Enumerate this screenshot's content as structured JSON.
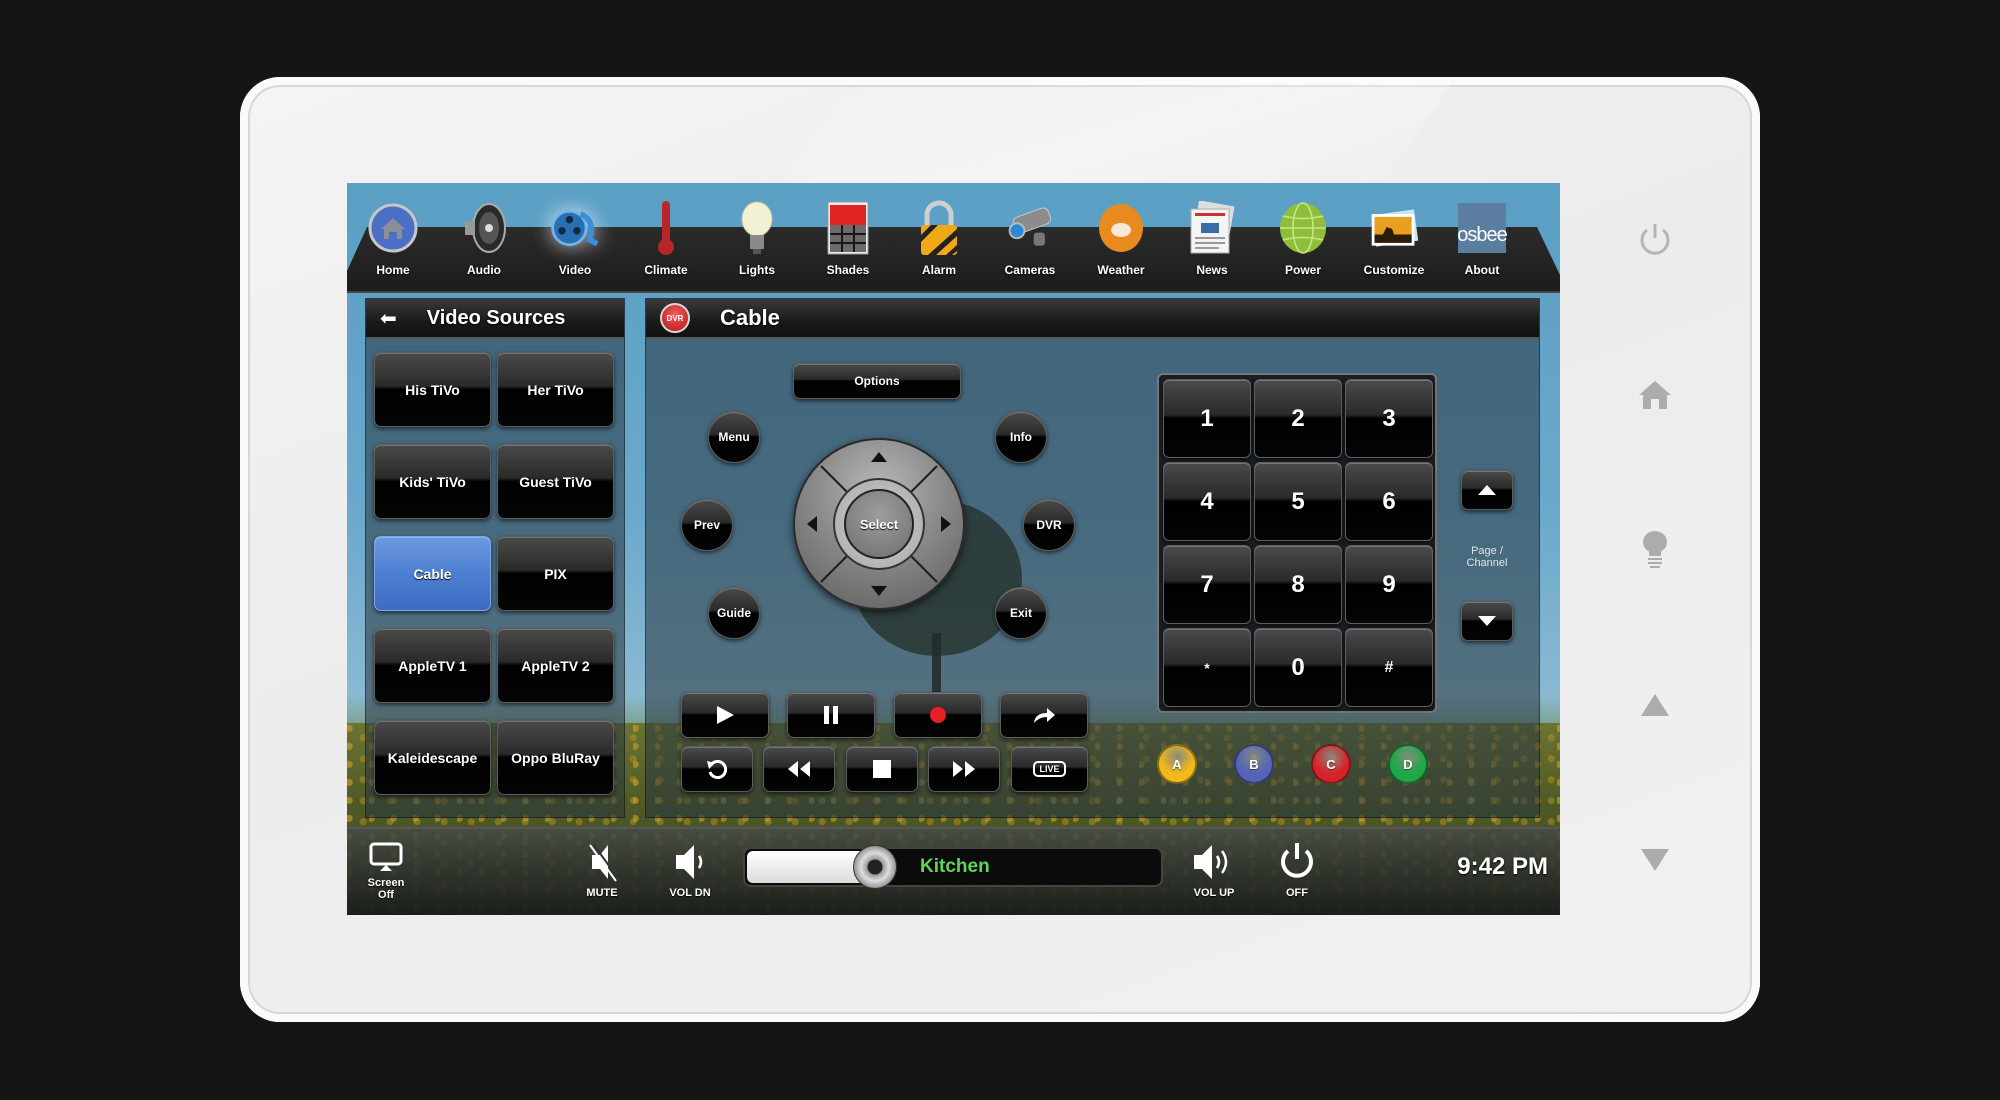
{
  "device": {
    "hardware_buttons": [
      {
        "name": "power",
        "icon": "power-icon"
      },
      {
        "name": "home",
        "icon": "home-icon"
      },
      {
        "name": "lights",
        "icon": "lightbulb-icon"
      },
      {
        "name": "up",
        "icon": "triangle-up-icon"
      },
      {
        "name": "down",
        "icon": "triangle-down-icon"
      }
    ]
  },
  "nav": {
    "active": "Video",
    "items": [
      {
        "label": "Home",
        "icon": "home-icon"
      },
      {
        "label": "Audio",
        "icon": "speaker-icon"
      },
      {
        "label": "Video",
        "icon": "film-reel-icon"
      },
      {
        "label": "Climate",
        "icon": "thermometer-icon"
      },
      {
        "label": "Lights",
        "icon": "lightbulb-icon"
      },
      {
        "label": "Shades",
        "icon": "shades-icon"
      },
      {
        "label": "Alarm",
        "icon": "padlock-icon"
      },
      {
        "label": "Cameras",
        "icon": "security-camera-icon"
      },
      {
        "label": "Weather",
        "icon": "weather-sun-icon"
      },
      {
        "label": "News",
        "icon": "newspaper-icon"
      },
      {
        "label": "Power",
        "icon": "globe-icon"
      },
      {
        "label": "Customize",
        "icon": "photo-icon"
      },
      {
        "label": "About",
        "icon": "osbee-logo",
        "logo_text": "osbee"
      }
    ]
  },
  "sources": {
    "title": "Video Sources",
    "selected": "Cable",
    "items": [
      "His TiVo",
      "Her TiVo",
      "Kids' TiVo",
      "Guest TiVo",
      "Cable",
      "PIX",
      "AppleTV 1",
      "AppleTV 2",
      "Kaleidescape",
      "Oppo BluRay"
    ]
  },
  "remote": {
    "title": "Cable",
    "badge": "DVR",
    "options_label": "Options",
    "menu_label": "Menu",
    "info_label": "Info",
    "prev_label": "Prev",
    "dvr_label": "DVR",
    "guide_label": "Guide",
    "exit_label": "Exit",
    "select_label": "Select",
    "transport_row1": [
      "play",
      "pause",
      "record",
      "skip-forward"
    ],
    "transport_row2": [
      "replay",
      "rewind",
      "stop",
      "fast-forward",
      "live"
    ],
    "live_label": "LIVE",
    "keypad": [
      "1",
      "2",
      "3",
      "4",
      "5",
      "6",
      "7",
      "8",
      "9",
      "*",
      "0",
      "#"
    ],
    "page_channel_label": "Page / Channel",
    "color_buttons": [
      {
        "label": "A",
        "color": "#f3b81c"
      },
      {
        "label": "B",
        "color": "#5564b8"
      },
      {
        "label": "C",
        "color": "#d8222a"
      },
      {
        "label": "D",
        "color": "#1ea848"
      }
    ]
  },
  "bottombar": {
    "screen_off_label": "Screen Off",
    "mute_label": "MUTE",
    "vol_dn_label": "VOL DN",
    "vol_up_label": "VOL UP",
    "off_label": "OFF",
    "room": "Kitchen",
    "volume_fraction": 0.26,
    "time": "9:42 PM"
  }
}
